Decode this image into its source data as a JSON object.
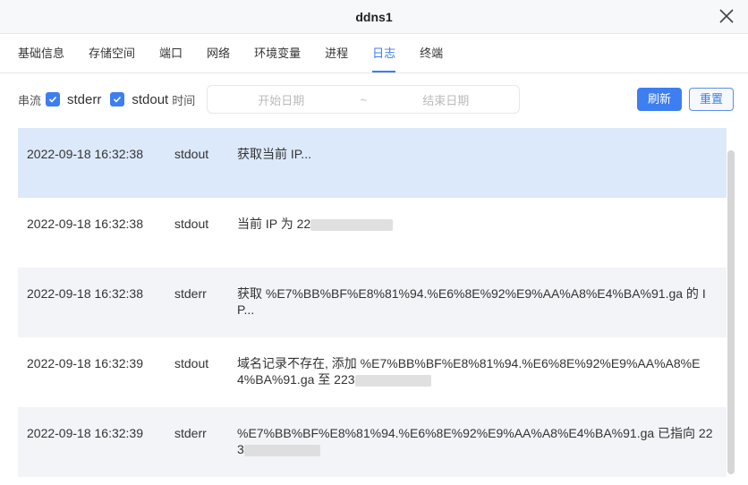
{
  "title": "ddns1",
  "tabs": [
    "基础信息",
    "存储空间",
    "端口",
    "网络",
    "环境变量",
    "进程",
    "日志",
    "终端"
  ],
  "active_tab": "日志",
  "filter": {
    "stream_label": "串流",
    "stderr": "stderr",
    "stdout": "stdout",
    "time_label": "时间",
    "start_placeholder": "开始日期",
    "separator": "~",
    "end_placeholder": "结束日期",
    "refresh": "刷新",
    "reset": "重置"
  },
  "logs": [
    {
      "time": "2022-09-18 16:32:38",
      "stream": "stdout",
      "message": "获取当前 IP..."
    },
    {
      "time": "2022-09-18 16:32:38",
      "stream": "stdout",
      "message": "当前 IP 为 22"
    },
    {
      "time": "2022-09-18 16:32:38",
      "stream": "stderr",
      "message": "获取 %E7%BB%BF%E8%81%94.%E6%8E%92%E9%AA%A8%E4%BA%91.ga 的 IP..."
    },
    {
      "time": "2022-09-18 16:32:39",
      "stream": "stdout",
      "message": "域名记录不存在, 添加 %E7%BB%BF%E8%81%94.%E6%8E%92%E9%AA%A8%E4%BA%91.ga 至 223"
    },
    {
      "time": "2022-09-18 16:32:39",
      "stream": "stderr",
      "message": "%E7%BB%BF%E8%81%94.%E6%8E%92%E9%AA%A8%E4%BA%91.ga 已指向 223"
    }
  ]
}
